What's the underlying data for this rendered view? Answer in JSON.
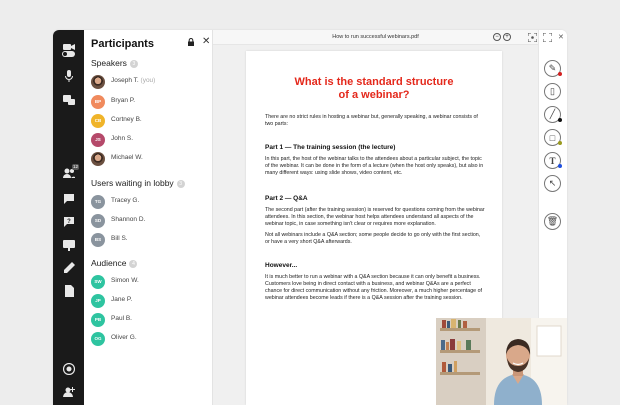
{
  "participants": {
    "title": "Participants",
    "speakers": {
      "label": "Speakers",
      "count": "3",
      "people": [
        {
          "name": "Joseph T.",
          "you": "(you)",
          "initials": "",
          "color": ""
        },
        {
          "name": "Bryan P.",
          "initials": "BP",
          "color": "#f08a5d"
        },
        {
          "name": "Cortney B.",
          "initials": "CB",
          "color": "#f0b429"
        },
        {
          "name": "John S.",
          "initials": "JS",
          "color": "#b5496a"
        },
        {
          "name": "Michael W.",
          "initials": "",
          "color": ""
        }
      ]
    },
    "lobby": {
      "label": "Users waiting in lobby",
      "count": "3",
      "people": [
        {
          "name": "Tracey G.",
          "initials": "TG",
          "color": "#8a949e"
        },
        {
          "name": "Shannon D.",
          "initials": "SD",
          "color": "#8a949e"
        },
        {
          "name": "Bill S.",
          "initials": "BS",
          "color": "#8a949e"
        }
      ]
    },
    "audience": {
      "label": "Audience",
      "count": "4",
      "people": [
        {
          "name": "Simon W.",
          "initials": "SW",
          "color": "#2ec4a0"
        },
        {
          "name": "Jane P.",
          "initials": "JP",
          "color": "#2ec4a0"
        },
        {
          "name": "Paul B.",
          "initials": "PB",
          "color": "#2ec4a0"
        },
        {
          "name": "Oliver G.",
          "initials": "OG",
          "color": "#2ec4a0"
        }
      ]
    }
  },
  "rail": {
    "badge": "12"
  },
  "viewer": {
    "file_name": "How to run successful webinars.pdf"
  },
  "doc": {
    "title_line1": "What is the standard structure",
    "title_line2": "of a webinar?",
    "intro": "There are no strict rules in hosting a webinar but, generally speaking, a webinar consists of two parts:",
    "part1_heading": "Part 1 — The training session (the lecture)",
    "part1_text": "In this part, the host of the webinar talks to the attendees about a particular subject, the topic of the webinar. It can be done in the form of a lecture (when the host only speaks), but also in many different ways: using slide shows, video content, etc.",
    "part2_heading": "Part 2 — Q&A",
    "part2_text": "The second part (after the training session) is reserved for questions coming from the webinar attendees. In this section, the webinar host helps attendees understand all aspects of the webinar topic, in case something isn't clear or requires more explanation.",
    "part2_text2": "Not all webinars include a Q&A section; some people decide to go only with the first section, or have a very short Q&A afterwards.",
    "however_heading": "However...",
    "however_text": "It is much better to run a webinar with a Q&A section because it can only benefit a business. Customers love being in direct contact with a business, and webinar Q&As are a perfect chance for direct communication without any friction. Moreover, a much higher percentage of webinar attendees become leads if there is a Q&A session after the training session."
  },
  "colors": {
    "pen_red": "#d32020",
    "pen_black": "#111111",
    "pen_olive": "#9a9a1e",
    "pen_blue": "#1f4fe0"
  }
}
